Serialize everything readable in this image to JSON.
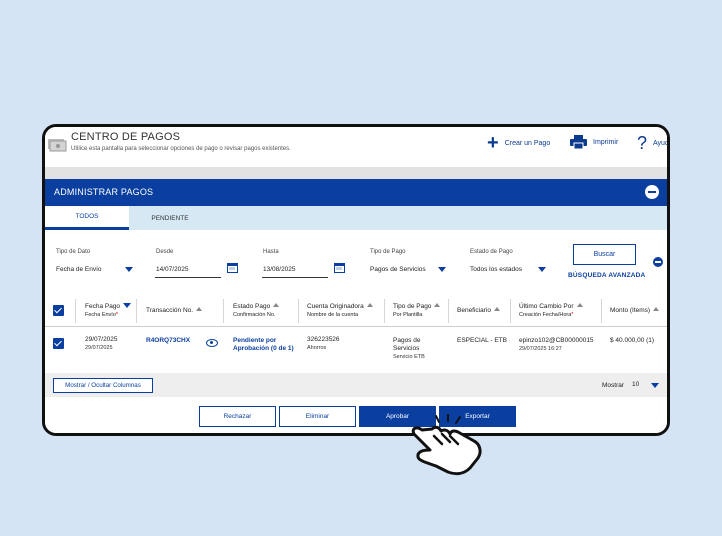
{
  "header": {
    "title": "CENTRO DE PAGOS",
    "subtitle": "Utilice esta pantalla para seleccionar opciones de pago o revisar pagos existentes.",
    "actions": {
      "create": "Crear un Pago",
      "print": "Imprimir",
      "help": "Ayud"
    }
  },
  "section": {
    "title": "ADMINISTRAR PAGOS"
  },
  "tabs": [
    {
      "label": "TODOS",
      "active": true
    },
    {
      "label": "PENDIENTE",
      "active": false
    }
  ],
  "filters": {
    "tipo_dato": {
      "label": "Tipo de Dato",
      "value": "Fecha de Envío"
    },
    "desde": {
      "label": "Desde",
      "value": "14/07/2025"
    },
    "hasta": {
      "label": "Hasta",
      "value": "13/08/2025"
    },
    "tipo_pago": {
      "label": "Tipo de Pago",
      "value": "Pagos de Servicios"
    },
    "estado_pago": {
      "label": "Estado de Pago",
      "value": "Todos los estados"
    },
    "buscar": "Buscar",
    "advanced": "BÚSQUEDA AVANZADA"
  },
  "table": {
    "columns": {
      "fecha": {
        "main": "Fecha Pago",
        "sub": "Fecha Envío",
        "required_mark": "*"
      },
      "transaccion": {
        "main": "Transacción No."
      },
      "estado": {
        "main": "Estado Pago",
        "sub": "Confirmación No."
      },
      "cuenta": {
        "main": "Cuenta Originadora",
        "sub": "Nombre de la cuenta"
      },
      "tipo": {
        "main": "Tipo de Pago",
        "sub": "Por Plantilla"
      },
      "beneficiario": {
        "main": "Beneficiario"
      },
      "ultimo": {
        "main": "Último Cambio Por",
        "sub": "Creación Fecha/Hora",
        "required_mark": "*"
      },
      "monto": {
        "main": "Monto (Items)"
      }
    },
    "rows": [
      {
        "fecha_pago": "29/07/2025",
        "fecha_envio": "29/07/2025",
        "transaccion": "R4ORQ73CHX",
        "estado": "Pendiente por Aprobación (0 de 1)",
        "cuenta": "326223526",
        "cuenta_nombre": "Ahorros",
        "tipo": "Pagos de Servicios",
        "tipo_plantilla": "Servicio ETB",
        "beneficiario": "ESPECIAL - ETB",
        "ultimo_usuario": "epinzo102@CB00000015",
        "ultimo_fecha": "29/07/2025 16:27",
        "monto": "$ 40.000,00 (1)"
      }
    ]
  },
  "footer": {
    "columns_button": "Mostrar / Ocultar Columnas",
    "show_label": "Mostrar",
    "show_value": "10"
  },
  "actions": {
    "reject": "Rechazar",
    "delete": "Eliminar",
    "approve": "Aprobar",
    "export": "Exportar"
  },
  "colors": {
    "primary": "#0a3fa0",
    "background": "#d4e4f4",
    "tab_bar": "#d7e8f5"
  }
}
